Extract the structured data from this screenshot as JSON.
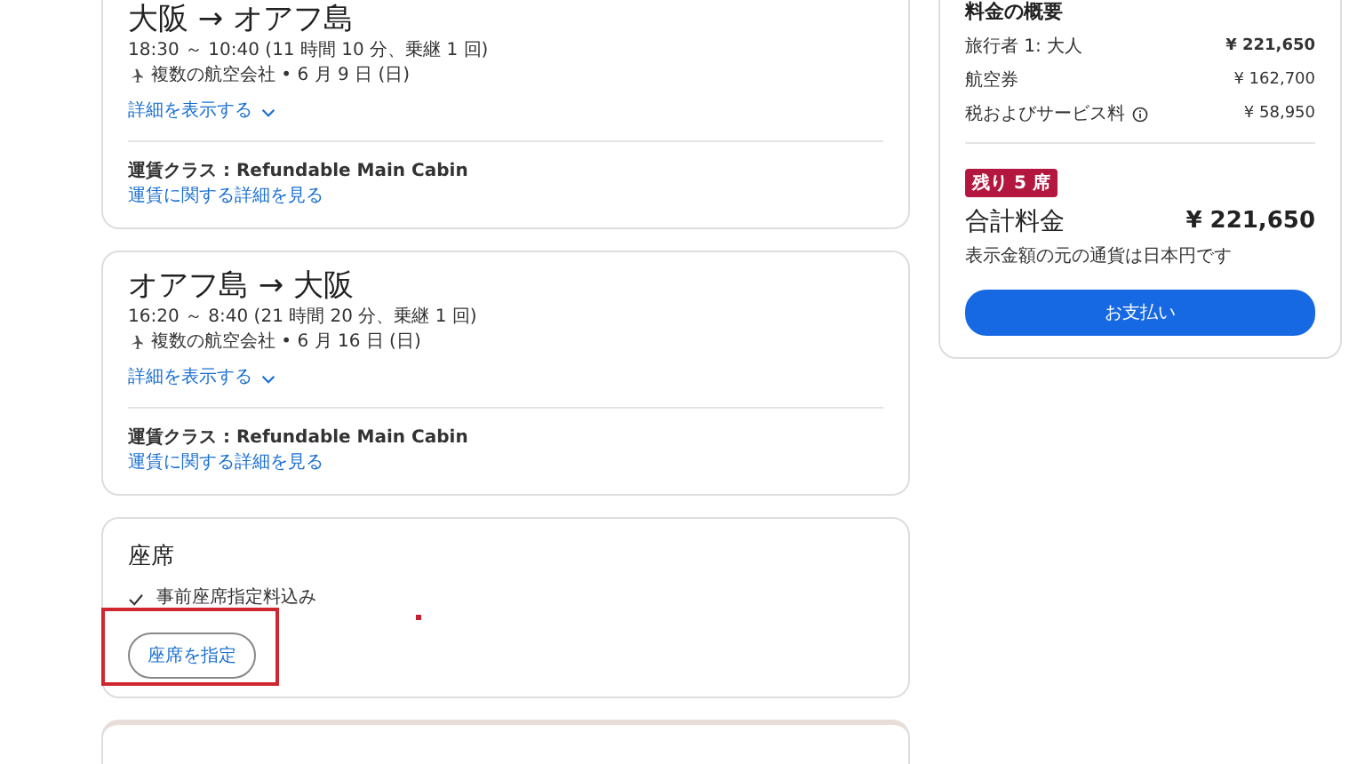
{
  "flights": [
    {
      "title": "大阪 → オアフ島",
      "times": "18:30 ～ 10:40 (11 時間 10 分、乗継 1 回)",
      "airline": "複数の航空会社 • 6 月 9 日 (日)",
      "details_link": "詳細を表示する",
      "fare_class": "運賃クラス : Refundable Main Cabin",
      "fare_link": "運賃に関する詳細を見る"
    },
    {
      "title": "オアフ島 → 大阪",
      "times": "16:20 ～ 8:40 (21 時間 20 分、乗継 1 回)",
      "airline": "複数の航空会社 • 6 月 16 日 (日)",
      "details_link": "詳細を表示する",
      "fare_class": "運賃クラス : Refundable Main Cabin",
      "fare_link": "運賃に関する詳細を見る"
    }
  ],
  "seats": {
    "title": "座席",
    "included": "事前座席指定料込み",
    "button": "座席を指定",
    "highlighted": true
  },
  "summary": {
    "title": "料金の概要",
    "lines": [
      {
        "label": "旅行者 1: 大人",
        "amount": "¥ 221,650",
        "kind": "bold"
      },
      {
        "label": "航空券",
        "amount": "¥ 162,700",
        "kind": "plain"
      },
      {
        "label": "税およびサービス料",
        "amount": "¥ 58,950",
        "kind": "info"
      }
    ],
    "badge": "残り 5 席",
    "total_label": "合計料金",
    "total": "¥ 221,650",
    "currency_note": "表示金額の元の通貨は日本円です",
    "pay_button": "お支払い"
  }
}
